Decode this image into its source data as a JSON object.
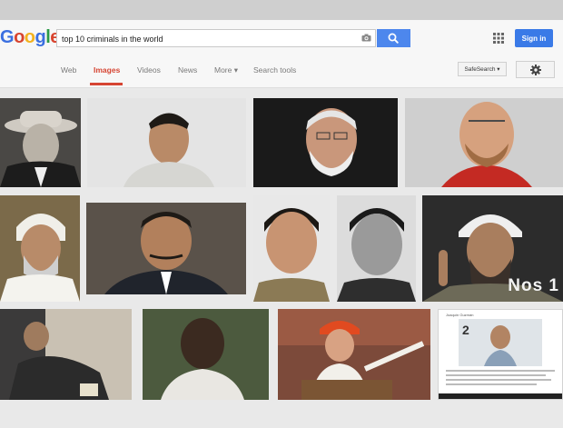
{
  "logo": {
    "G": "G",
    "o1": "o",
    "o2": "o",
    "g": "g",
    "l": "l",
    "e": "e"
  },
  "search": {
    "query": "top 10 criminals in the world"
  },
  "header": {
    "signin_label": "Sign in"
  },
  "nav": {
    "items": [
      "Web",
      "Images",
      "Videos",
      "News",
      "More ▾",
      "Search tools"
    ],
    "active": "Images"
  },
  "tools": {
    "safe_search_label": "SafeSearch ▾"
  },
  "results": {
    "overlay_text": "Nos 1",
    "document_page_number": "2",
    "document_title": "Joaquín Guzmán"
  },
  "colors": {
    "accent_blue": "#4d87ed",
    "active_tab": "#d64533"
  }
}
